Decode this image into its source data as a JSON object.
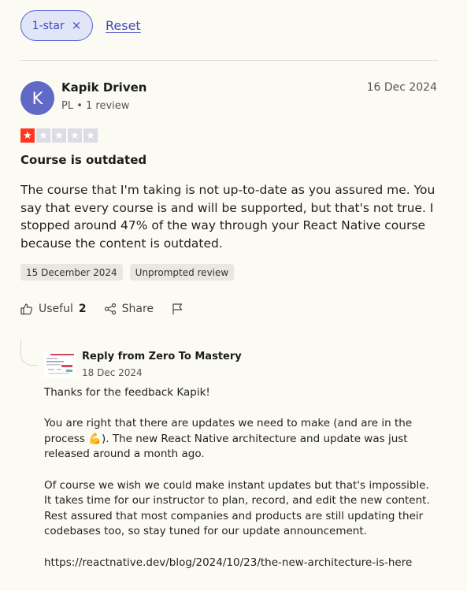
{
  "filter": {
    "chip_label": "1-star",
    "chip_close": "×",
    "reset_label": "Reset"
  },
  "review": {
    "avatar_letter": "K",
    "reviewer_name": "Kapik Driven",
    "reviewer_meta": "PL • 1 review",
    "date": "16 Dec 2024",
    "rating": 1,
    "rating_max": 5,
    "star_glyph": "★",
    "title": "Course is outdated",
    "body": "The course that I'm taking is not up-to-date as you assured me. You say that every course is and will be supported, but that's not true. I stopped around 47% of the way through your React Native course because the content is outdated.",
    "tags": [
      "15 December 2024",
      "Unprompted review"
    ],
    "useful_label": "Useful",
    "useful_count": "2",
    "share_label": "Share"
  },
  "reply": {
    "from": "Reply from Zero To Mastery",
    "date": "18 Dec 2024",
    "paragraphs": [
      "Thanks for the feedback Kapik!",
      "You are right that there are updates we need to make (and are in the process 💪). The new React Native architecture and update was just released around a month ago.",
      "Of course we wish we could make instant updates but that's impossible. It takes time for our instructor to plan, record, and edit the new content. Rest assured that most companies and products are still updating their codebases too, so stay tuned for our update announcement.",
      "https://reactnative.dev/blog/2024/10/23/the-new-architecture-is-here"
    ]
  },
  "icons": {
    "close": "close-icon",
    "star": "star-icon",
    "useful": "thumbs-up-icon",
    "share": "share-icon",
    "report": "flag-icon",
    "reply_logo": "company-logo"
  },
  "colors": {
    "accent": "#5462d6",
    "star_on": "#ff3722",
    "star_off": "#dcdce6",
    "avatar": "#6169c7",
    "background": "#fcfbf3"
  }
}
